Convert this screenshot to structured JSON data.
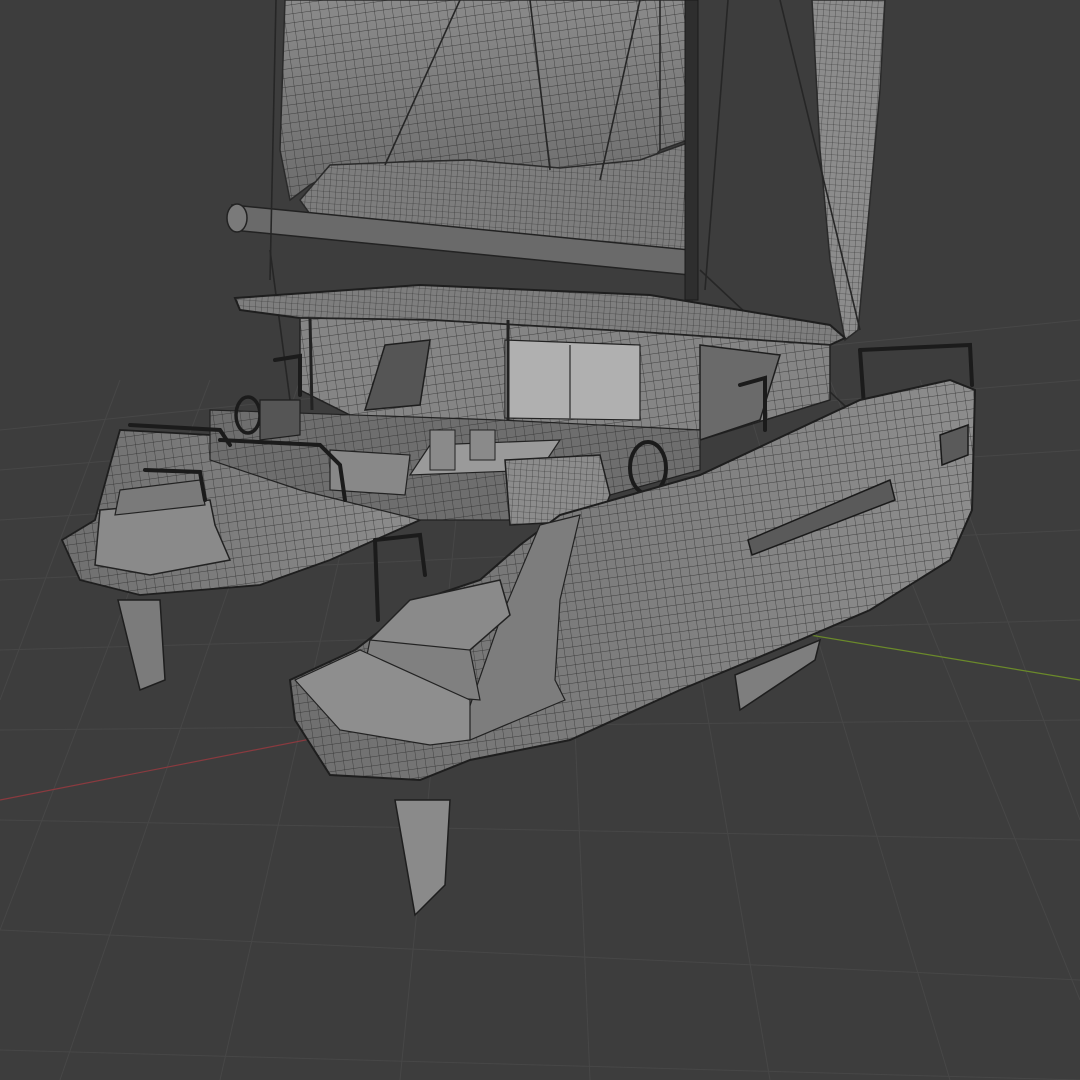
{
  "viewport": {
    "background_color": "#3d3d3d",
    "grid_color": "#4a4a4a",
    "x_axis_color": "#8a3a3f",
    "y_axis_color": "#6b8a2a"
  },
  "model": {
    "object": "catamaran",
    "display": "wireframe-on-shaded",
    "surface_color": "#8f8f8f",
    "wire_color": "#2a2a2a"
  }
}
